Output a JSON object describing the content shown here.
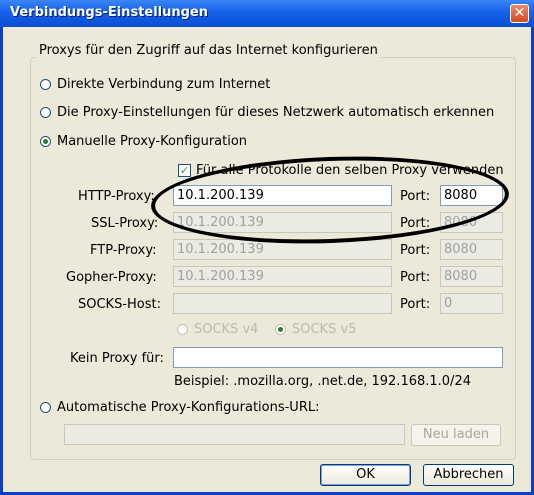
{
  "window": {
    "title": "Verbindungs-Einstellungen",
    "close_symbol": "✕"
  },
  "group": {
    "legend": "Proxys für den Zugriff auf das Internet konfigurieren",
    "direct": "Direkte Verbindung zum Internet",
    "auto_detect": "Die Proxy-Einstellungen für dieses Netzwerk automatisch erkennen",
    "manual": "Manuelle Proxy-Konfiguration",
    "same_proxy": "Für alle Protokolle den selben Proxy verwenden",
    "http_label": "HTTP-Proxy:",
    "ssl_label": "SSL-Proxy:",
    "ftp_label": "FTP-Proxy:",
    "gopher_label": "Gopher-Proxy:",
    "socks_label": "SOCKS-Host:",
    "port_label": "Port:",
    "http_value": "10.1.200.139",
    "ssl_value": "10.1.200.139",
    "ftp_value": "10.1.200.139",
    "gopher_value": "10.1.200.139",
    "socks_value": "",
    "http_port": "8080",
    "ssl_port": "8080",
    "ftp_port": "8080",
    "gopher_port": "8080",
    "socks_port": "0",
    "socks_v4": "SOCKS v4",
    "socks_v5": "SOCKS v5",
    "no_proxy_label": "Kein Proxy für:",
    "no_proxy_value": "",
    "example": "Beispiel: .mozilla.org, .net.de, 192.168.1.0/24",
    "auto_url": "Automatische Proxy-Konfigurations-URL:",
    "auto_url_value": "",
    "reload": "Neu laden"
  },
  "buttons": {
    "ok": "OK",
    "cancel": "Abbrechen"
  }
}
